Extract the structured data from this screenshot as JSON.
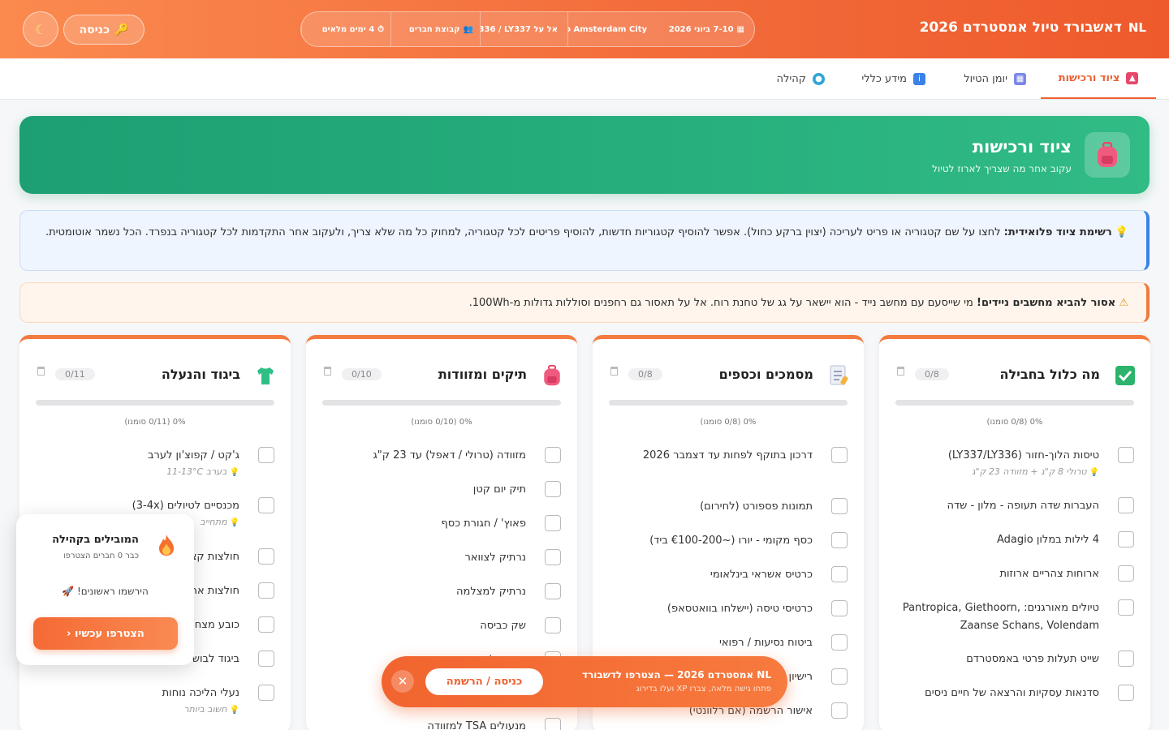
{
  "header": {
    "flag": "NL",
    "title": "דאשבורד טיול אמסטרדם 2026",
    "trip_segments": [
      {
        "icon": "calendar-icon",
        "glyph": "▦",
        "text": "7-10 ביוני 2026"
      },
      {
        "icon": "hotel-icon",
        "glyph": "",
        "text": "Adagio Amsterdam City"
      },
      {
        "icon": "flight-icon",
        "glyph": "",
        "text": "אל על LY336 / LY337"
      },
      {
        "icon": "group-icon",
        "glyph": "👥",
        "text": "קבוצת חברים"
      },
      {
        "icon": "timer-icon",
        "glyph": "⏱",
        "text": "4 ימים מלאים"
      }
    ],
    "login_label": "כניסה",
    "login_icon": "🔑",
    "theme_icon": "☾"
  },
  "tabs": [
    {
      "label": "ציוד ורכישות",
      "icon": "backpack-icon",
      "glyph": "▲",
      "color": "#e8476a",
      "active": true
    },
    {
      "label": "יומן הטיול",
      "icon": "calendar-icon",
      "glyph": "▦",
      "color": "#7b86e8",
      "active": false
    },
    {
      "label": "מידע כללי",
      "icon": "info-icon",
      "glyph": "i",
      "color": "#3a82e8",
      "active": false
    },
    {
      "label": "קהילה",
      "icon": "globe-icon",
      "glyph": "●",
      "color": "#2fa5d8",
      "active": false
    }
  ],
  "hero": {
    "title": "ציוד ורכישות",
    "subtitle": "עקוב אחר מה שצריך לארוז לטיול"
  },
  "notices": {
    "info": {
      "icon": "💡",
      "title": "רשימת ציוד פלואידית:",
      "text": " לחצו על שם קטגוריה או פריט לעריכה (יצוין ברקע כחול). אפשר להוסיף קטגוריות חדשות, להוסיף פריטים לכל קטגוריה, למחוק כל מה שלא צריך, ולעקוב אחר התקדמות לכל קטגוריה בנפרד. הכל נשמר אוטומטית."
    },
    "warn": {
      "icon": "⚠",
      "title": "אסור להביא מחשבים ניידים!",
      "text": " מי שייסעם עם מחשב נייד - הוא יישאר על גג של טחנת רוח. אל על תאסור גם רחפנים וסוללות גדולות מ-100Wh."
    }
  },
  "categories": [
    {
      "title": "מה כלול בחבילה",
      "icon": "checkbox-icon",
      "count": "0/8",
      "progress": 0,
      "progress_text": "0% (0/8 סומנו)",
      "items": [
        {
          "label": "טיסות הלוך-חזור (LY337/LY336)",
          "note": "טרולי 8 ק\"ג + מזוודה 23 ק\"ג"
        },
        {
          "label": "העברות שדה תעופה - מלון - שדה",
          "note": ""
        },
        {
          "label": "4 לילות במלון Adagio",
          "note": ""
        },
        {
          "label": "ארוחות צהריים ארוזות",
          "note": ""
        },
        {
          "label": "טיולים מאורגנים: Pantropica, Giethoorn, Zaanse Schans, Volendam",
          "note": ""
        },
        {
          "label": "שייט תעלות פרטי באמסטרדם",
          "note": ""
        },
        {
          "label": "סדנאות עסקיות והרצאה של חיים ניסים",
          "note": ""
        }
      ]
    },
    {
      "title": "מסמכים וכספים",
      "icon": "document-icon",
      "count": "0/8",
      "progress": 0,
      "progress_text": "0% (0/8 סומנו)",
      "items": [
        {
          "label": "דרכון בתוקף לפחות עד דצמבר 2026",
          "note": ""
        },
        {
          "label": "תמונות פספורט (לחירום)",
          "note": ""
        },
        {
          "label": "כסף מקומי - יורו (~€100-200 ביד)",
          "note": ""
        },
        {
          "label": "כרטיס אשראי בינלאומי",
          "note": ""
        },
        {
          "label": "כרטיסי טיסה (יישלחו בוואטסאפ)",
          "note": ""
        },
        {
          "label": "ביטוח נסיעות / רפואי",
          "note": ""
        },
        {
          "label": "רישיון נהיגה בינלאומי",
          "note": ""
        },
        {
          "label": "אישור הרשמה (אם רלוונטי)",
          "note": ""
        }
      ]
    },
    {
      "title": "תיקים ומזוודות",
      "icon": "backpack-icon",
      "count": "0/10",
      "progress": 0,
      "progress_text": "0% (0/10 סומנו)",
      "items": [
        {
          "label": "מזוודה (טרולי / דאפל) עד 23 ק\"ג",
          "note": ""
        },
        {
          "label": "תיק יום קטן",
          "note": ""
        },
        {
          "label": "פאוץ' / חגורת כסף",
          "note": ""
        },
        {
          "label": "נרתיק לצוואר",
          "note": ""
        },
        {
          "label": "נרתיק למצלמה",
          "note": ""
        },
        {
          "label": "שק כביסה",
          "note": ""
        },
        {
          "label": "שקיות לאריזת בגדים",
          "note": ""
        },
        {
          "label": "מנעולים TSA למזוודה",
          "note": ""
        }
      ]
    },
    {
      "title": "ביגוד והנעלה",
      "icon": "shirt-icon",
      "count": "0/11",
      "progress": 0,
      "progress_text": "0% (0/11 סומנו)",
      "items": [
        {
          "label": "ג'קט / קפוצ'ון לערב",
          "note": "בערב 11-13°C"
        },
        {
          "label": "מכנסיים לטיולים (3-4x)",
          "note": "מתחייב"
        },
        {
          "label": "חולצות קצרות",
          "note": ""
        },
        {
          "label": "חולצות ארוכות",
          "note": ""
        },
        {
          "label": "כובע מצחייה",
          "note": ""
        },
        {
          "label": "ביגוד לבוש",
          "note": ""
        },
        {
          "label": "נעלי הליכה נוחות",
          "note": "חשוב ביותר"
        }
      ]
    }
  ],
  "leaderboard": {
    "title": "המובילים בקהילה",
    "subtitle": "כבר 0 חברים הצטרפו",
    "first_text": "הירשמו ראשונים! 🚀",
    "button_label": "הצטרפו עכשיו ‹"
  },
  "join_banner": {
    "title": "NL אמסטרדם 2026 — הצטרפו לדשבורד",
    "subtitle": "פתחו גישה מלאה, צברו XP ועלו בדירוג",
    "button_label": "כניסה / הרשמה",
    "close_icon": "✕"
  },
  "colors": {
    "accent": "#ef5f2f",
    "success": "#27b07d",
    "info": "#3a82e8"
  }
}
